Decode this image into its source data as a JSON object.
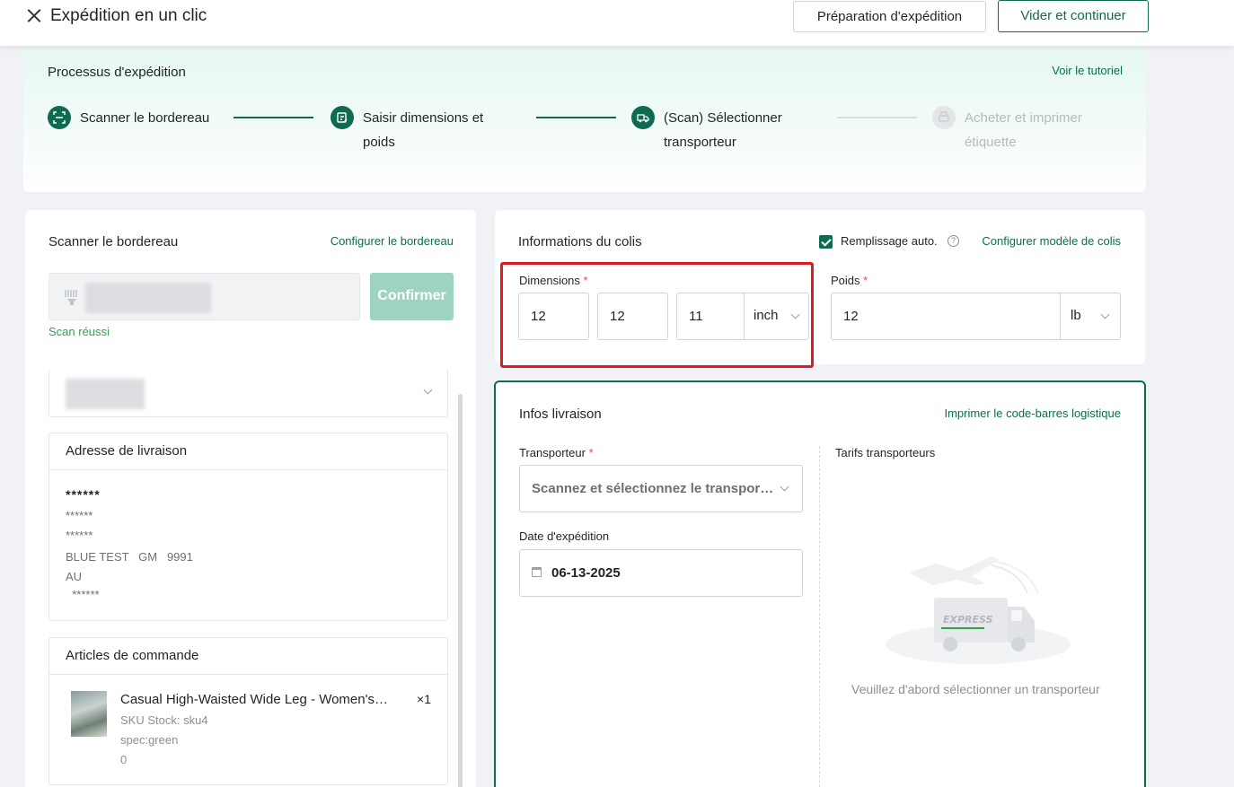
{
  "header": {
    "title": "Expédition en un clic",
    "btn_preparation": "Préparation d'expédition",
    "btn_vider": "Vider et continuer"
  },
  "process": {
    "title": "Processus d'expédition",
    "tutorial_link": "Voir le tutoriel",
    "steps": [
      {
        "label": "Scanner le bordereau",
        "state": "done"
      },
      {
        "label": "Saisir dimensions et poids",
        "state": "done"
      },
      {
        "label": "(Scan) Sélectionner transporteur",
        "state": "active"
      },
      {
        "label": "Acheter et imprimer étiquette",
        "state": "pending"
      }
    ]
  },
  "scan": {
    "title": "Scanner le bordereau",
    "config_link": "Configurer le bordereau",
    "confirm_button": "Confirmer",
    "status": "Scan réussi"
  },
  "address": {
    "title": "Adresse de livraison",
    "lines": [
      "******",
      "******",
      "******",
      "BLUE TEST   GM   9991",
      "AU",
      "  ******"
    ]
  },
  "order_items": {
    "title": "Articles de commande",
    "items": [
      {
        "name": "Casual High-Waisted Wide Leg - Women's Fashion",
        "qty": "×1",
        "sku": "SKU Stock: sku4",
        "spec": "spec:green",
        "extra": "0"
      }
    ]
  },
  "package": {
    "title": "Informations du colis",
    "auto_fill_label": "Remplissage auto.",
    "auto_fill_checked": true,
    "config_model_link": "Configurer modèle de colis",
    "dimensions_label": "Dimensions",
    "length": "12",
    "width": "12",
    "height": "11",
    "dim_unit": "inch",
    "weight_label": "Poids",
    "weight": "12",
    "weight_unit": "lb"
  },
  "shipping": {
    "title": "Infos livraison",
    "barcode_link": "Imprimer le code-barres logistique",
    "carrier_label": "Transporteur",
    "carrier_placeholder": "Scannez et sélectionnez le transporteur",
    "date_label": "Date d'expédition",
    "date_value": "06-13-2025",
    "rates_label": "Tarifs transporteurs",
    "empty_illustration_text": "EXPRESS",
    "empty_message": "Veuillez d'abord sélectionner un transporteur"
  },
  "colors": {
    "primary": "#0e6b52",
    "primary_light": "#9fd3c1",
    "success": "#2fa44f",
    "required": "#e5484d",
    "highlight_box": "#e01b1b"
  }
}
